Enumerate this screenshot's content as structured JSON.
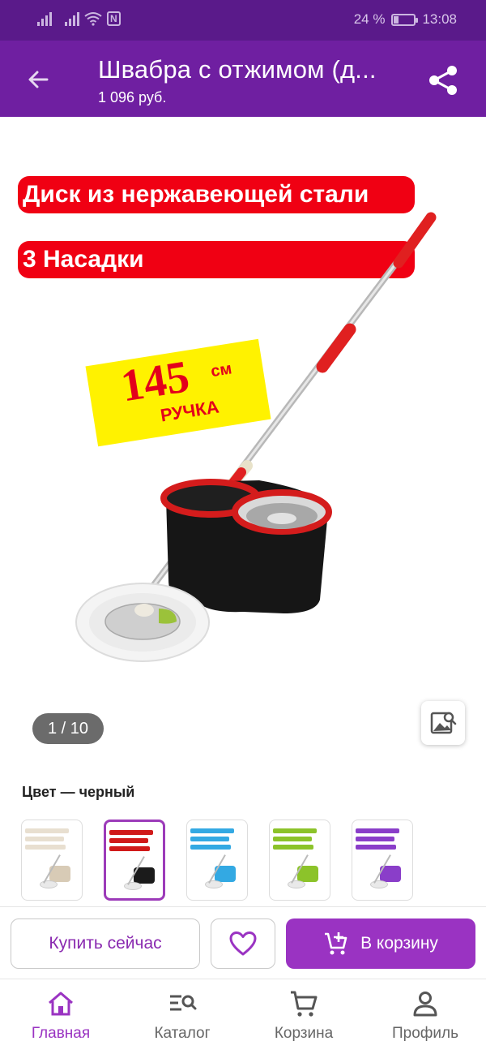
{
  "status_bar": {
    "battery_percent": "24 %",
    "battery_level": 0.24,
    "time": "13:08",
    "nfc_label": "N"
  },
  "app_bar": {
    "title": "Швабра с отжимом (д...",
    "price": "1 096 руб.",
    "back_icon": "arrow-left-icon",
    "share_icon": "share-icon"
  },
  "gallery": {
    "banner_1": "Диск из нержавеющей стали",
    "banner_2": "3 Насадки",
    "sticker_number": "145",
    "sticker_unit": "см",
    "sticker_text": "РУЧКА",
    "counter": "1 / 10",
    "zoom_icon": "image-search-icon"
  },
  "color": {
    "label": "Цвет — черный",
    "swatches": [
      {
        "name": "beige",
        "accent": "#d8cbb6",
        "selected": false
      },
      {
        "name": "black",
        "accent": "#d01a1a",
        "selected": true
      },
      {
        "name": "blue",
        "accent": "#33a9e3",
        "selected": false
      },
      {
        "name": "green",
        "accent": "#8cc32a",
        "selected": false
      },
      {
        "name": "purple",
        "accent": "#8a3ec9",
        "selected": false
      }
    ]
  },
  "actions": {
    "buy_now": "Купить сейчас",
    "favorite_icon": "heart-icon",
    "add_to_cart": "В корзину",
    "cart_icon": "cart-plus-icon"
  },
  "nav": {
    "items": [
      {
        "label": "Главная",
        "icon": "home-icon",
        "active": true
      },
      {
        "label": "Каталог",
        "icon": "catalog-search-icon",
        "active": false
      },
      {
        "label": "Корзина",
        "icon": "cart-icon",
        "active": false
      },
      {
        "label": "Профиль",
        "icon": "profile-icon",
        "active": false
      }
    ]
  },
  "colors": {
    "brand": "#6f1fa1",
    "accent": "#9a33c2",
    "status_bar": "#5a1a8a"
  }
}
